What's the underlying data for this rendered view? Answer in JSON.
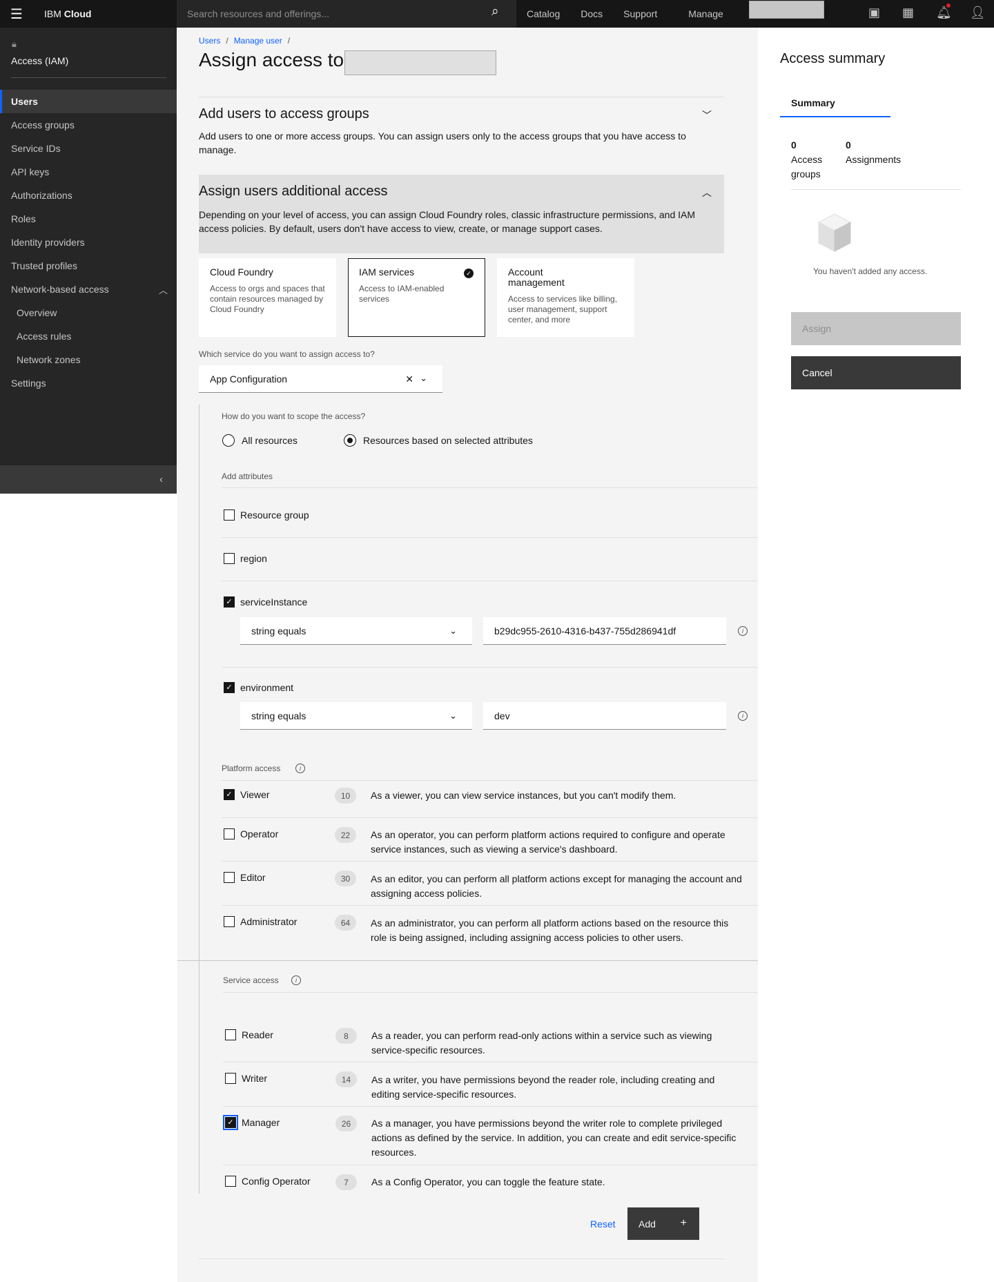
{
  "header": {
    "brand_prefix": "IBM",
    "brand_name": "Cloud",
    "search_placeholder": "Search resources and offerings...",
    "nav": [
      "Catalog",
      "Docs",
      "Support",
      "Manage"
    ]
  },
  "sidebar": {
    "title": "Access (IAM)",
    "items": [
      {
        "label": "Users",
        "active": true
      },
      {
        "label": "Access groups"
      },
      {
        "label": "Service IDs"
      },
      {
        "label": "API keys"
      },
      {
        "label": "Authorizations"
      },
      {
        "label": "Roles"
      },
      {
        "label": "Identity providers"
      },
      {
        "label": "Trusted profiles"
      },
      {
        "label": "Network-based access",
        "expanded": true
      },
      {
        "label": "Overview",
        "sub": true
      },
      {
        "label": "Access rules",
        "sub": true
      },
      {
        "label": "Network zones",
        "sub": true
      },
      {
        "label": "Settings"
      }
    ]
  },
  "breadcrumb": [
    "Users",
    "Manage user"
  ],
  "page_title": "Assign access to",
  "accordion_groups": {
    "title": "Add users to access groups",
    "desc": "Add users to one or more access groups. You can assign users only to the access groups that you have access to manage."
  },
  "accordion_additional": {
    "title": "Assign users additional access",
    "desc": "Depending on your level of access, you can assign Cloud Foundry roles, classic infrastructure permissions, and IAM access policies. By default, users don't have access to view, create, or manage support cases."
  },
  "tiles": [
    {
      "title": "Cloud Foundry",
      "desc": "Access to orgs and spaces that contain resources managed by Cloud Foundry"
    },
    {
      "title": "IAM services",
      "desc": "Access to IAM-enabled services",
      "selected": true
    },
    {
      "title": "Account management",
      "desc": "Access to services like billing, user management, support center, and more"
    }
  ],
  "service_question": "Which service do you want to assign access to?",
  "service_value": "App Configuration",
  "scope_question": "How do you want to scope the access?",
  "scope_options": [
    "All resources",
    "Resources based on selected attributes"
  ],
  "scope_selected": 1,
  "add_attributes_label": "Add attributes",
  "attributes": [
    {
      "label": "Resource group",
      "checked": false
    },
    {
      "label": "region",
      "checked": false
    },
    {
      "label": "serviceInstance",
      "checked": true,
      "operator": "string equals",
      "value": "b29dc955-2610-4316-b437-755d286941df"
    },
    {
      "label": "environment",
      "checked": true,
      "operator": "string equals",
      "value": "dev"
    }
  ],
  "platform_access": {
    "label": "Platform access",
    "roles": [
      {
        "name": "Viewer",
        "count": "10",
        "checked": true,
        "desc": "As a viewer, you can view service instances, but you can't modify them."
      },
      {
        "name": "Operator",
        "count": "22",
        "checked": false,
        "desc": "As an operator, you can perform platform actions required to configure and operate service instances, such as viewing a service's dashboard."
      },
      {
        "name": "Editor",
        "count": "30",
        "checked": false,
        "desc": "As an editor, you can perform all platform actions except for managing the account and assigning access policies."
      },
      {
        "name": "Administrator",
        "count": "64",
        "checked": false,
        "desc": "As an administrator, you can perform all platform actions based on the resource this role is being assigned, including assigning access policies to other users."
      }
    ]
  },
  "service_access": {
    "label": "Service access",
    "roles": [
      {
        "name": "Reader",
        "count": "8",
        "checked": false,
        "desc": "As a reader, you can perform read-only actions within a service such as viewing service-specific resources."
      },
      {
        "name": "Writer",
        "count": "14",
        "checked": false,
        "desc": "As a writer, you have permissions beyond the reader role, including creating and editing service-specific resources."
      },
      {
        "name": "Manager",
        "count": "26",
        "checked": true,
        "desc": "As a manager, you have permissions beyond the writer role to complete privileged actions as defined by the service. In addition, you can create and edit service-specific resources."
      },
      {
        "name": "Config Operator",
        "count": "7",
        "checked": false,
        "desc": "As a Config Operator, you can toggle the feature state."
      }
    ]
  },
  "actions": {
    "reset": "Reset",
    "add": "Add"
  },
  "summary": {
    "title": "Access summary",
    "tab": "Summary",
    "groups_count": "0",
    "groups_label": "Access groups",
    "assignments_count": "0",
    "assignments_label": "Assignments",
    "empty": "You haven't added any access.",
    "assign": "Assign",
    "cancel": "Cancel"
  },
  "colors": {
    "accent": "#0f62fe",
    "dark": "#161616",
    "notification": "#da1e28"
  }
}
